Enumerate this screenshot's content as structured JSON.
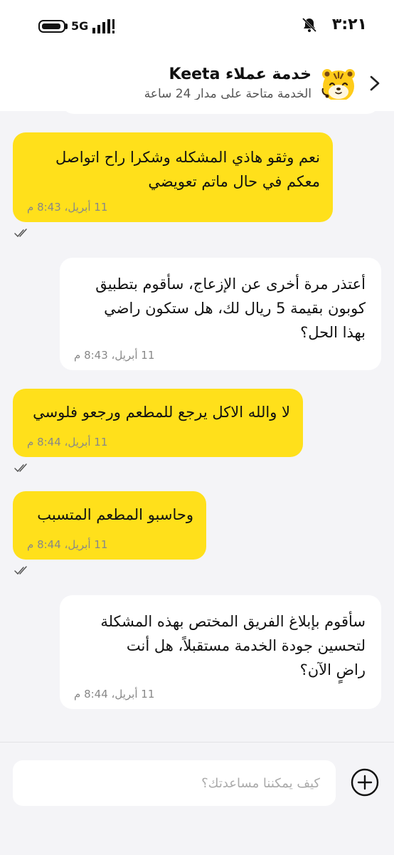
{
  "status_bar": {
    "time": "٣:٢١",
    "network": "5G"
  },
  "header": {
    "title": "خدمة عملاء Keeta",
    "subtitle": "الخدمة متاحة على مدار 24 ساعة"
  },
  "messages": [
    {
      "direction": "sent",
      "text": "نعم وثقو هاذي المشكله وشكرا راح اتواصل\nمعكم في حال ماتم تعويضي",
      "time": "11 أبريل، 8:43 م",
      "read": true
    },
    {
      "direction": "received",
      "text": "أعتذر مرة أخرى عن الإزعاج، سأقوم بتطبيق\nكوبون بقيمة 5 ريال لك، هل ستكون راضي\nبهذا الحل؟",
      "time": "11 أبريل، 8:43 م"
    },
    {
      "direction": "sent",
      "text": "لا والله الاكل يرجع للمطعم ورجعو فلوسي",
      "time": "11 أبريل، 8:44 م",
      "read": true
    },
    {
      "direction": "sent",
      "text": "وحاسبو المطعم المتسبب",
      "time": "11 أبريل، 8:44 م",
      "read": true
    },
    {
      "direction": "received",
      "text": "سأقوم بإبلاغ الفريق المختص بهذه المشكلة\nلتحسين جودة الخدمة مستقبلاً، هل أنت\nراضٍ الآن؟",
      "time": "11 أبريل، 8:44 م"
    }
  ],
  "composer": {
    "placeholder": "كيف يمكننا مساعدتك؟"
  },
  "colors": {
    "sent_bubble": "#ffe01b",
    "received_bubble": "#ffffff",
    "background": "#f4f4f7"
  },
  "icons": {
    "back": "chevron-right-icon",
    "avatar": "tiger-mascot-icon",
    "add": "plus-circle-icon",
    "read_receipt": "double-check-icon"
  }
}
